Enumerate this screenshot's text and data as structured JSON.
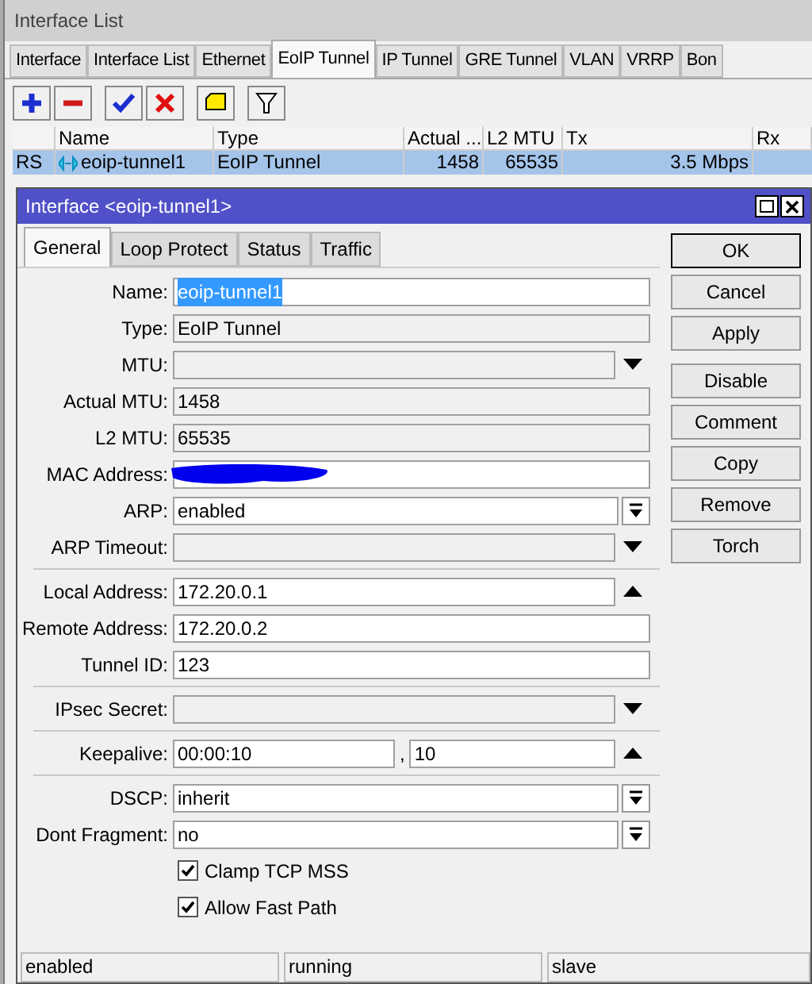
{
  "window": {
    "title": "Interface List"
  },
  "tabs": [
    {
      "label": "Interface",
      "selected": false
    },
    {
      "label": "Interface List",
      "selected": false
    },
    {
      "label": "Ethernet",
      "selected": false
    },
    {
      "label": "EoIP Tunnel",
      "selected": true
    },
    {
      "label": "IP Tunnel",
      "selected": false
    },
    {
      "label": "GRE Tunnel",
      "selected": false
    },
    {
      "label": "VLAN",
      "selected": false
    },
    {
      "label": "VRRP",
      "selected": false
    },
    {
      "label": "Bon",
      "selected": false
    }
  ],
  "toolbar": [
    {
      "kind": "add"
    },
    {
      "kind": "remove"
    },
    {
      "kind": "enable"
    },
    {
      "kind": "disable"
    },
    {
      "kind": "comment"
    },
    {
      "kind": "filter"
    }
  ],
  "table": {
    "columns": [
      "",
      "Name",
      "Type",
      "Actual ...",
      "L2 MTU",
      "Tx",
      "Rx"
    ],
    "rows": [
      {
        "selected": true,
        "flags": "RS",
        "name": "eoip-tunnel1",
        "type": "EoIP Tunnel",
        "actual_mtu": "1458",
        "l2_mtu": "65535",
        "tx": "3.5 Mbps"
      }
    ]
  },
  "dialog": {
    "title": "Interface <eoip-tunnel1>",
    "tabs": [
      {
        "label": "General",
        "selected": true
      },
      {
        "label": "Loop Protect",
        "selected": false
      },
      {
        "label": "Status",
        "selected": false
      },
      {
        "label": "Traffic",
        "selected": false
      }
    ],
    "groups": [
      [
        {
          "label": "Name:",
          "value": "eoip-tunnel1",
          "kind": "text",
          "focused": true
        },
        {
          "label": "Type:",
          "value": "EoIP Tunnel",
          "kind": "readonly"
        },
        {
          "label": "MTU:",
          "kind": "dropdown"
        },
        {
          "label": "Actual MTU:",
          "value": "1458",
          "kind": "readonly"
        },
        {
          "label": "L2 MTU:",
          "value": "65535",
          "kind": "readonly"
        },
        {
          "label": "MAC Address:",
          "kind": "redacted"
        },
        {
          "label": "ARP:",
          "value": "enabled",
          "kind": "select"
        },
        {
          "label": "ARP Timeout:",
          "kind": "dropdown"
        }
      ],
      [
        {
          "label": "Local Address:",
          "value": "172.20.0.1",
          "kind": "collapse"
        },
        {
          "label": "Remote Address:",
          "value": "172.20.0.2",
          "kind": "text"
        },
        {
          "label": "Tunnel ID:",
          "value": "123",
          "kind": "text"
        }
      ],
      [
        {
          "label": "IPsec Secret:",
          "kind": "dropdown"
        }
      ],
      [
        {
          "label": "Keepalive:",
          "value": "00:00:10",
          "value2": "10",
          "sep": ",",
          "kind": "pair"
        }
      ],
      [
        {
          "label": "DSCP:",
          "value": "inherit",
          "kind": "select"
        },
        {
          "label": "Dont Fragment:",
          "value": "no",
          "kind": "select"
        },
        {
          "label": "Clamp TCP MSS",
          "kind": "checkbox",
          "checked": true
        },
        {
          "label": "Allow Fast Path",
          "kind": "checkbox",
          "checked": true
        }
      ]
    ],
    "buttons": [
      [
        "OK",
        "Cancel",
        "Apply"
      ],
      [
        "Disable",
        "Comment",
        "Copy",
        "Remove",
        "Torch"
      ]
    ],
    "status_bar": [
      "enabled",
      "running",
      "slave"
    ]
  }
}
